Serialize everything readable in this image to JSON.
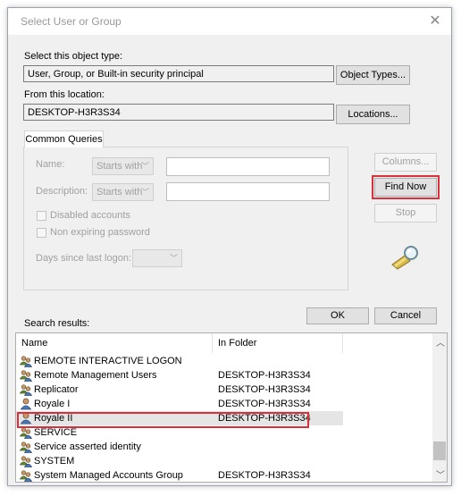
{
  "dialog": {
    "title": "Select User or Group",
    "object_type_label": "Select this object type:",
    "object_type_value": "User, Group, or Built-in security principal",
    "object_types_button": "Object Types...",
    "location_label": "From this location:",
    "location_value": "DESKTOP-H3R3S34",
    "locations_button": "Locations..."
  },
  "queries": {
    "tab_label": "Common Queries",
    "name_label": "Name:",
    "name_mode": "Starts with",
    "description_label": "Description:",
    "description_mode": "Starts with",
    "disabled_accounts": "Disabled accounts",
    "non_expiring_password": "Non expiring password",
    "days_since_logon": "Days since last logon:",
    "columns_button": "Columns...",
    "find_now_button": "Find Now",
    "stop_button": "Stop"
  },
  "footer": {
    "ok_button": "OK",
    "cancel_button": "Cancel",
    "results_label": "Search results:"
  },
  "results": {
    "columns": [
      "Name",
      "In Folder"
    ],
    "rows": [
      {
        "name": "REMOTE INTERACTIVE LOGON",
        "folder": "",
        "icon": "group-icon"
      },
      {
        "name": "Remote Management Users",
        "folder": "DESKTOP-H3R3S34",
        "icon": "group-icon"
      },
      {
        "name": "Replicator",
        "folder": "DESKTOP-H3R3S34",
        "icon": "group-icon"
      },
      {
        "name": "Royale I",
        "folder": "DESKTOP-H3R3S34",
        "icon": "user-icon"
      },
      {
        "name": "Royale II",
        "folder": "DESKTOP-H3R3S34",
        "icon": "user-icon"
      },
      {
        "name": "SERVICE",
        "folder": "",
        "icon": "group-icon"
      },
      {
        "name": "Service asserted identity",
        "folder": "",
        "icon": "group-icon"
      },
      {
        "name": "SYSTEM",
        "folder": "",
        "icon": "group-icon"
      },
      {
        "name": "System Managed Accounts Group",
        "folder": "DESKTOP-H3R3S34",
        "icon": "group-icon"
      }
    ]
  },
  "colors": {
    "highlight": "#d9303a",
    "selected_row": "#e5e5e5"
  }
}
